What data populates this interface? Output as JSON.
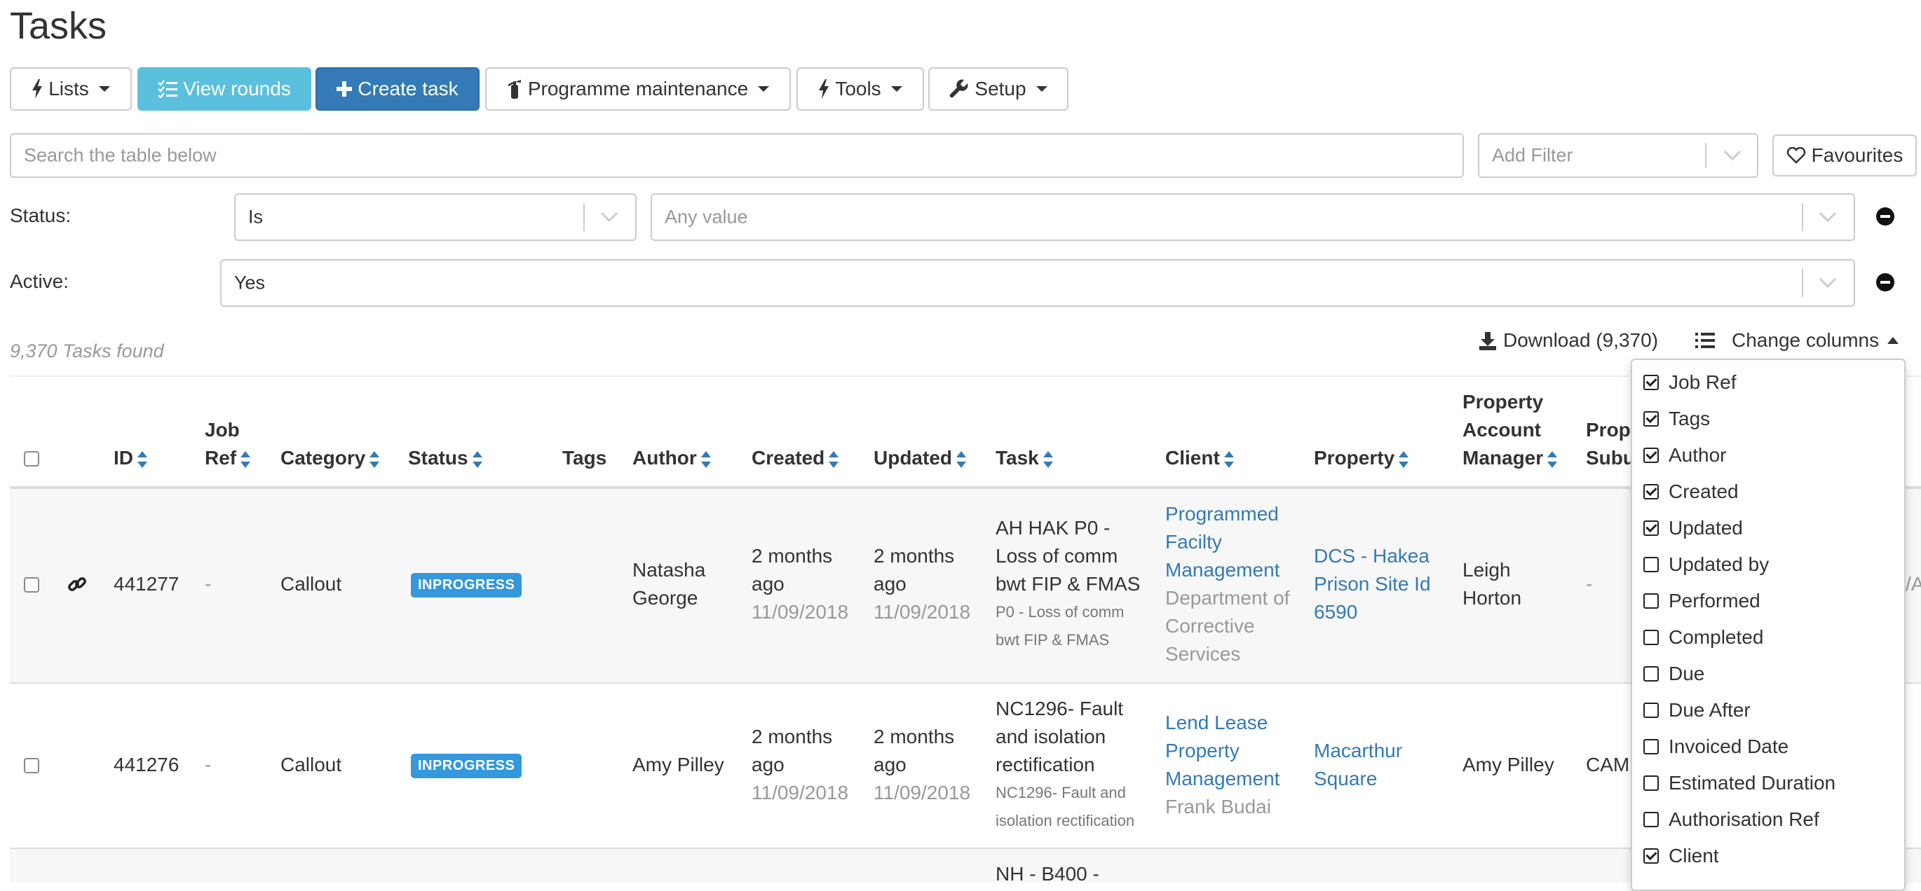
{
  "page": {
    "title": "Tasks"
  },
  "toolbar": {
    "lists": "Lists",
    "view_rounds": "View rounds",
    "create_task": "Create task",
    "programme_maintenance": "Programme maintenance",
    "tools": "Tools",
    "setup": "Setup"
  },
  "search": {
    "placeholder": "Search the table below",
    "add_filter": "Add Filter",
    "favourites": "Favourites"
  },
  "filters": {
    "status_label": "Status:",
    "status_operator": "Is",
    "status_value": "Any value",
    "active_label": "Active:",
    "active_value": "Yes"
  },
  "results": {
    "count_text": "9,370 Tasks found",
    "download": "Download (9,370)",
    "change_columns": "Change columns"
  },
  "table": {
    "headers": {
      "id": "ID",
      "job_ref_1": "Job",
      "job_ref_2": "Ref",
      "category": "Category",
      "status": "Status",
      "tags": "Tags",
      "author": "Author",
      "created": "Created",
      "updated": "Updated",
      "task": "Task",
      "client": "Client",
      "property": "Property",
      "pam_1": "Property",
      "pam_2": "Account",
      "pam_3": "Manager",
      "prop_sub_1": "Prop",
      "prop_sub_2": "Subu"
    },
    "rows": [
      {
        "id": "441277",
        "job_ref": "-",
        "category": "Callout",
        "status": "INPROGRESS",
        "author_1": "Natasha",
        "author_2": "George",
        "created_1": "2 months",
        "created_2": "ago",
        "created_date": "11/09/2018",
        "updated_1": "2 months",
        "updated_2": "ago",
        "updated_date": "11/09/2018",
        "task_1": "AH HAK P0 -",
        "task_2": "Loss of comm",
        "task_3": "bwt FIP & FMAS",
        "task_sub_1": "P0 - Loss of comm",
        "task_sub_2": "bwt FIP & FMAS",
        "client_1": "Programmed",
        "client_2": "Facilty",
        "client_3": "Management",
        "client_sub_1": "Department of",
        "client_sub_2": "Corrective",
        "client_sub_3": "Services",
        "property_1": "DCS - Hakea",
        "property_2": "Prison Site Id",
        "property_3": "6590",
        "pam_1": "Leigh",
        "pam_2": "Horton",
        "prop_sub": "-",
        "edge": "/A"
      },
      {
        "id": "441276",
        "job_ref": "-",
        "category": "Callout",
        "status": "INPROGRESS",
        "author": "Amy Pilley",
        "created_1": "2 months",
        "created_2": "ago",
        "created_date": "11/09/2018",
        "updated_1": "2 months",
        "updated_2": "ago",
        "updated_date": "11/09/2018",
        "task_1": "NC1296- Fault",
        "task_2": "and isolation",
        "task_3": "rectification",
        "task_sub_1": "NC1296- Fault and",
        "task_sub_2": "isolation rectification",
        "client_1": "Lend Lease",
        "client_2": "Property",
        "client_3": "Management",
        "client_sub_1": "Frank Budai",
        "property_1": "Macarthur",
        "property_2": "Square",
        "pam": "Amy Pilley",
        "prop_sub": "CAM"
      },
      {
        "task_1": "NH - B400 -"
      }
    ]
  },
  "columns_menu": [
    {
      "label": "Job Ref",
      "checked": true
    },
    {
      "label": "Tags",
      "checked": true
    },
    {
      "label": "Author",
      "checked": true
    },
    {
      "label": "Created",
      "checked": true
    },
    {
      "label": "Updated",
      "checked": true
    },
    {
      "label": "Updated by",
      "checked": false
    },
    {
      "label": "Performed",
      "checked": false
    },
    {
      "label": "Completed",
      "checked": false
    },
    {
      "label": "Due",
      "checked": false
    },
    {
      "label": "Due After",
      "checked": false
    },
    {
      "label": "Invoiced Date",
      "checked": false
    },
    {
      "label": "Estimated Duration",
      "checked": false
    },
    {
      "label": "Authorisation Ref",
      "checked": false
    },
    {
      "label": "Client",
      "checked": true
    }
  ],
  "colors": {
    "primary": "#337ab7",
    "info": "#5bc0de",
    "badge": "#3498db",
    "link": "#337ab7"
  }
}
